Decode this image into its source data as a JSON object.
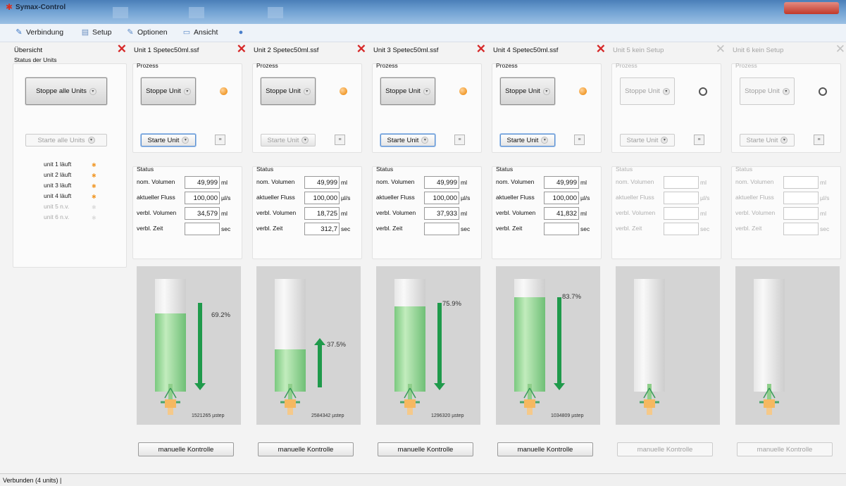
{
  "window": {
    "title": "Symax-Control"
  },
  "menu": {
    "items": [
      {
        "label": "Verbindung",
        "icon": "pencil-icon"
      },
      {
        "label": "Setup",
        "icon": "document-icon"
      },
      {
        "label": "Optionen",
        "icon": "wrench-icon"
      },
      {
        "label": "Ansicht",
        "icon": "window-icon"
      },
      {
        "label": "",
        "icon": "help-icon"
      }
    ]
  },
  "overview": {
    "header": "Übersicht",
    "group_label": "Status der Units",
    "stop_all_label": "Stoppe alle Units",
    "start_all_label": "Starte alle Units",
    "units": [
      {
        "label": "unit 1 läuft",
        "active": true
      },
      {
        "label": "unit 2 läuft",
        "active": true
      },
      {
        "label": "unit 3 läuft",
        "active": true
      },
      {
        "label": "unit 4 läuft",
        "active": true
      },
      {
        "label": "unit 5 n.v.",
        "active": false
      },
      {
        "label": "unit 6 n.v.",
        "active": false
      }
    ]
  },
  "labels": {
    "process": "Prozess",
    "stop_unit": "Stoppe Unit",
    "start_unit": "Starte Unit",
    "status": "Status",
    "nom_volume": "nom. Volumen",
    "current_flow": "aktueller Fluss",
    "remaining_volume": "verbl. Volumen",
    "remaining_time": "verbl. Zeit",
    "manual_control": "manuelle Kontrolle"
  },
  "units": [
    {
      "header": "Unit 1   Spetec50ml.ssf",
      "enabled": true,
      "nom_volume": "49,999",
      "nom_volume_unit": "ml",
      "flow": "100,000",
      "flow_unit": "µl/s",
      "remaining_volume": "34,579",
      "remaining_volume_unit": "ml",
      "remaining_time": "",
      "time_unit": "sec",
      "fill": 0.692,
      "percent": "69.2%",
      "direction": "down",
      "steps": "1521265 µstep"
    },
    {
      "header": "Unit 2   Spetec50ml.ssf",
      "enabled": true,
      "nom_volume": "49,999",
      "nom_volume_unit": "ml",
      "flow": "100,000",
      "flow_unit": "µl/s",
      "remaining_volume": "18,725",
      "remaining_volume_unit": "ml",
      "remaining_time": "312,7",
      "time_unit": "sec",
      "fill": 0.375,
      "percent": "37.5%",
      "direction": "up",
      "steps": "2584342 µstep"
    },
    {
      "header": "Unit 3   Spetec50ml.ssf",
      "enabled": true,
      "nom_volume": "49,999",
      "nom_volume_unit": "ml",
      "flow": "100,000",
      "flow_unit": "µl/s",
      "remaining_volume": "37,933",
      "remaining_volume_unit": "ml",
      "remaining_time": "",
      "time_unit": "sec",
      "fill": 0.759,
      "percent": "75.9%",
      "direction": "down",
      "steps": "1296320 µstep"
    },
    {
      "header": "Unit 4   Spetec50ml.ssf",
      "enabled": true,
      "nom_volume": "49,999",
      "nom_volume_unit": "ml",
      "flow": "100,000",
      "flow_unit": "µl/s",
      "remaining_volume": "41,832",
      "remaining_volume_unit": "ml",
      "remaining_time": "",
      "time_unit": "sec",
      "fill": 0.837,
      "percent": "83.7%",
      "direction": "down",
      "steps": "1034809 µstep"
    },
    {
      "header": "Unit 5   kein Setup",
      "enabled": false,
      "nom_volume": "",
      "nom_volume_unit": "ml",
      "flow": "",
      "flow_unit": "µl/s",
      "remaining_volume": "",
      "remaining_volume_unit": "ml",
      "remaining_time": "",
      "time_unit": "sec",
      "fill": 0,
      "percent": "",
      "direction": "none",
      "steps": ""
    },
    {
      "header": "Unit 6   kein Setup",
      "enabled": false,
      "nom_volume": "",
      "nom_volume_unit": "ml",
      "flow": "",
      "flow_unit": "µl/s",
      "remaining_volume": "",
      "remaining_volume_unit": "ml",
      "remaining_time": "",
      "time_unit": "sec",
      "fill": 0,
      "percent": "",
      "direction": "none",
      "steps": ""
    }
  ],
  "statusbar": {
    "text": "Verbunden (4 units)  |"
  },
  "colors": {
    "close_red": "#d62a2a",
    "lamp_orange": "#f19a2c",
    "fill_green": "#7ac97f",
    "arrow_green": "#1f9a4b"
  }
}
